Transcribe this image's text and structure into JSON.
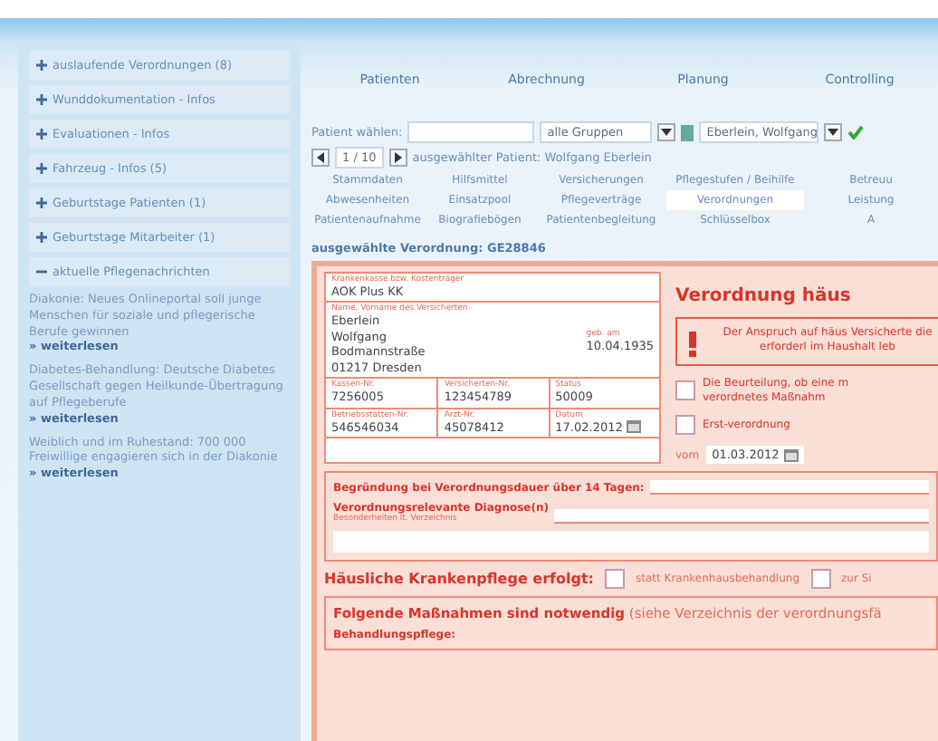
{
  "sidebar": {
    "items": [
      {
        "label": "auslaufende Verordnungen (8)",
        "expanded": false
      },
      {
        "label": "Wunddokumentation - Infos",
        "expanded": false
      },
      {
        "label": "Evaluationen - Infos",
        "expanded": false
      },
      {
        "label": "Fahrzeug - Infos (5)",
        "expanded": false
      },
      {
        "label": "Geburtstage Patienten (1)",
        "expanded": false
      },
      {
        "label": "Geburtstage Mitarbeiter (1)",
        "expanded": false
      },
      {
        "label": "aktuelle Pflegenachrichten",
        "expanded": true
      }
    ],
    "news": [
      {
        "text": "Diakonie: Neues Onlineportal soll junge Menschen für soziale und pflegerische Berufe gewinnen",
        "link": "» weiterlesen"
      },
      {
        "text": "Diabetes-Behandlung: Deutsche Diabetes Gesellschaft gegen Heilkunde-Übertragung auf Pflegeberufe",
        "link": "» weiterlesen"
      },
      {
        "text": "Weiblich und im Ruhestand: 700 000 Freiwillige engagieren sich in der Diakonie",
        "link": "» weiterlesen"
      }
    ]
  },
  "nav": [
    {
      "label": "Patienten"
    },
    {
      "label": "Abrechnung"
    },
    {
      "label": "Planung"
    },
    {
      "label": "Controlling"
    }
  ],
  "patient_picker": {
    "label": "Patient wählen:",
    "group": "alle Gruppen",
    "patient": "Eberlein, Wolfgang"
  },
  "pager": {
    "position": "1 / 10",
    "selected_patient": "ausgewählter Patient: Wolfgang Eberlein"
  },
  "subtabs": [
    [
      {
        "label": "Stammdaten",
        "selected": false
      },
      {
        "label": "Hilfsmittel",
        "selected": false
      },
      {
        "label": "Versicherungen",
        "selected": false
      },
      {
        "label": "Pflegestufen / Beihilfe",
        "selected": false
      },
      {
        "label": "Betreuu",
        "selected": false
      }
    ],
    [
      {
        "label": "Abwesenheiten",
        "selected": false
      },
      {
        "label": "Einsatzpool",
        "selected": false
      },
      {
        "label": "Pflegeverträge",
        "selected": false
      },
      {
        "label": "Verordnungen",
        "selected": true
      },
      {
        "label": "Leistung",
        "selected": false
      }
    ],
    [
      {
        "label": "Patientenaufnahme",
        "selected": false
      },
      {
        "label": "Biografiebögen",
        "selected": false
      },
      {
        "label": "Patientenbegleitung",
        "selected": false
      },
      {
        "label": "Schlüsselbox",
        "selected": false
      },
      {
        "label": "A",
        "selected": false
      }
    ]
  ],
  "selected_prescription": "ausgewählte Verordnung: GE28846",
  "form": {
    "insurer_label": "Krankenkasse bzw. Kostenträger",
    "insurer": "AOK Plus KK",
    "name_label": "Name, Vorname des Versicherten",
    "name_lines": [
      "Eberlein",
      "Wolfgang",
      "Bodmannstraße",
      "01217 Dresden"
    ],
    "birth_label": "geb. am",
    "birth": "10.04.1935",
    "row1": [
      {
        "label": "Kassen-Nr.",
        "value": "7256005"
      },
      {
        "label": "Versicherten-Nr.",
        "value": "123454789"
      },
      {
        "label": "Status",
        "value": "50009"
      }
    ],
    "row2": [
      {
        "label": "Betriebsstätten-Nr.",
        "value": "546546034"
      },
      {
        "label": "Arzt-Nr.",
        "value": "45078412"
      },
      {
        "label": "Datum",
        "value": "17.02.2012"
      }
    ],
    "title": "Verordnung häus",
    "warning": "Der Anspruch auf häus Versicherte die erforderl im Haushalt leb",
    "options": [
      {
        "label": "Die Beurteilung, ob eine m verordnetes Maßnahm",
        "checked": false
      },
      {
        "label": "Erst-verordnung",
        "checked": false
      }
    ],
    "from_label": "vom",
    "from_date": "01.03.2012",
    "reason_label": "Begründung bei Verordnungsdauer über 14 Tagen:",
    "diagnosis_label": "Verordnungsrelevante Diagnose(n)",
    "diagnosis_hint": "Besonderheiten lt. Verzeichnis",
    "care_label": "Häusliche Krankenpflege erfolgt:",
    "care_options": [
      {
        "label": "statt Krankenhausbehandlung",
        "checked": false
      },
      {
        "label": "zur Si",
        "checked": false
      }
    ],
    "measures": "**Folgende Maßnahmen sind notwendig** (siehe Verzeichnis der verordnungsfä",
    "treatment_label": "Behandlungspflege:"
  }
}
